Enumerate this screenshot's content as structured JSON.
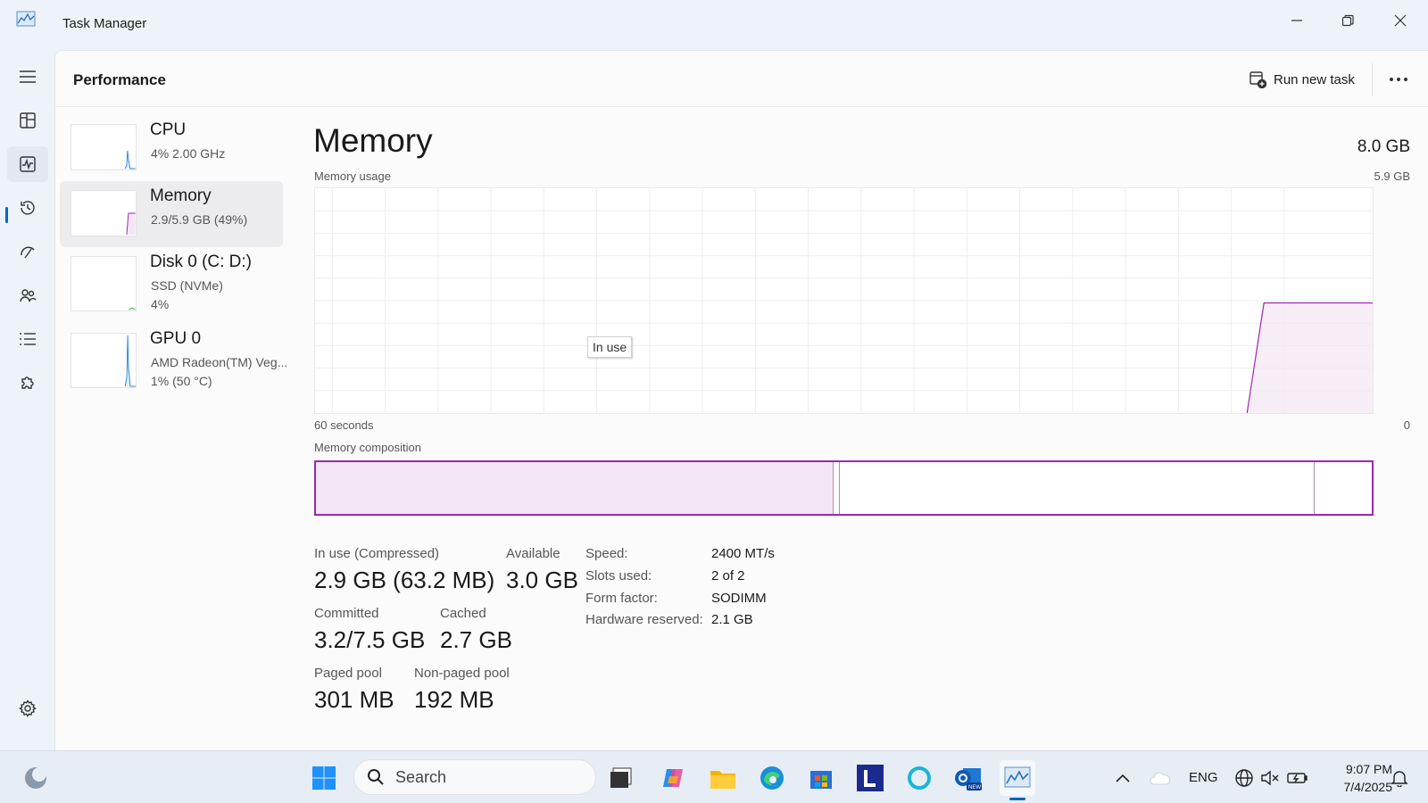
{
  "window": {
    "title": "Task Manager"
  },
  "header": {
    "title": "Performance",
    "run_task_label": "Run new task"
  },
  "devices": [
    {
      "name": "CPU",
      "line1": "4%  2.00 GHz",
      "line2": ""
    },
    {
      "name": "Memory",
      "line1": "2.9/5.9 GB (49%)",
      "line2": ""
    },
    {
      "name": "Disk 0 (C: D:)",
      "line1": "SSD (NVMe)",
      "line2": "4%"
    },
    {
      "name": "GPU 0",
      "line1": "AMD Radeon(TM) Veg...",
      "line2": "1%  (50 °C)"
    }
  ],
  "detail": {
    "title": "Memory",
    "total": "8.0 GB",
    "usage_label": "Memory usage",
    "usage_max": "5.9 GB",
    "axis_left": "60 seconds",
    "axis_right": "0",
    "tooltip": "In use",
    "composition_label": "Memory composition",
    "composition": {
      "in_use_fraction": 0.49,
      "modified_fraction": 0.005,
      "standby_fraction": 0.45
    },
    "usage_history_fraction": 0.49
  },
  "stats": {
    "in_use_label": "In use (Compressed)",
    "in_use_value": "2.9 GB (63.2 MB)",
    "available_label": "Available",
    "available_value": "3.0 GB",
    "committed_label": "Committed",
    "committed_value": "3.2/7.5 GB",
    "cached_label": "Cached",
    "cached_value": "2.7 GB",
    "paged_label": "Paged pool",
    "paged_value": "301 MB",
    "nonpaged_label": "Non-paged pool",
    "nonpaged_value": "192 MB"
  },
  "specs": [
    {
      "label": "Speed:",
      "value": "2400 MT/s"
    },
    {
      "label": "Slots used:",
      "value": "2 of 2"
    },
    {
      "label": "Form factor:",
      "value": "SODIMM"
    },
    {
      "label": "Hardware reserved:",
      "value": "2.1 GB"
    }
  ],
  "taskbar": {
    "search_placeholder": "Search",
    "language": "ENG",
    "time": "9:07 PM",
    "date": "7/4/2025"
  },
  "colors": {
    "memory_accent": "#9c27b0",
    "memory_fill": "#f3e6f4",
    "selection_blue": "#0067c0"
  }
}
